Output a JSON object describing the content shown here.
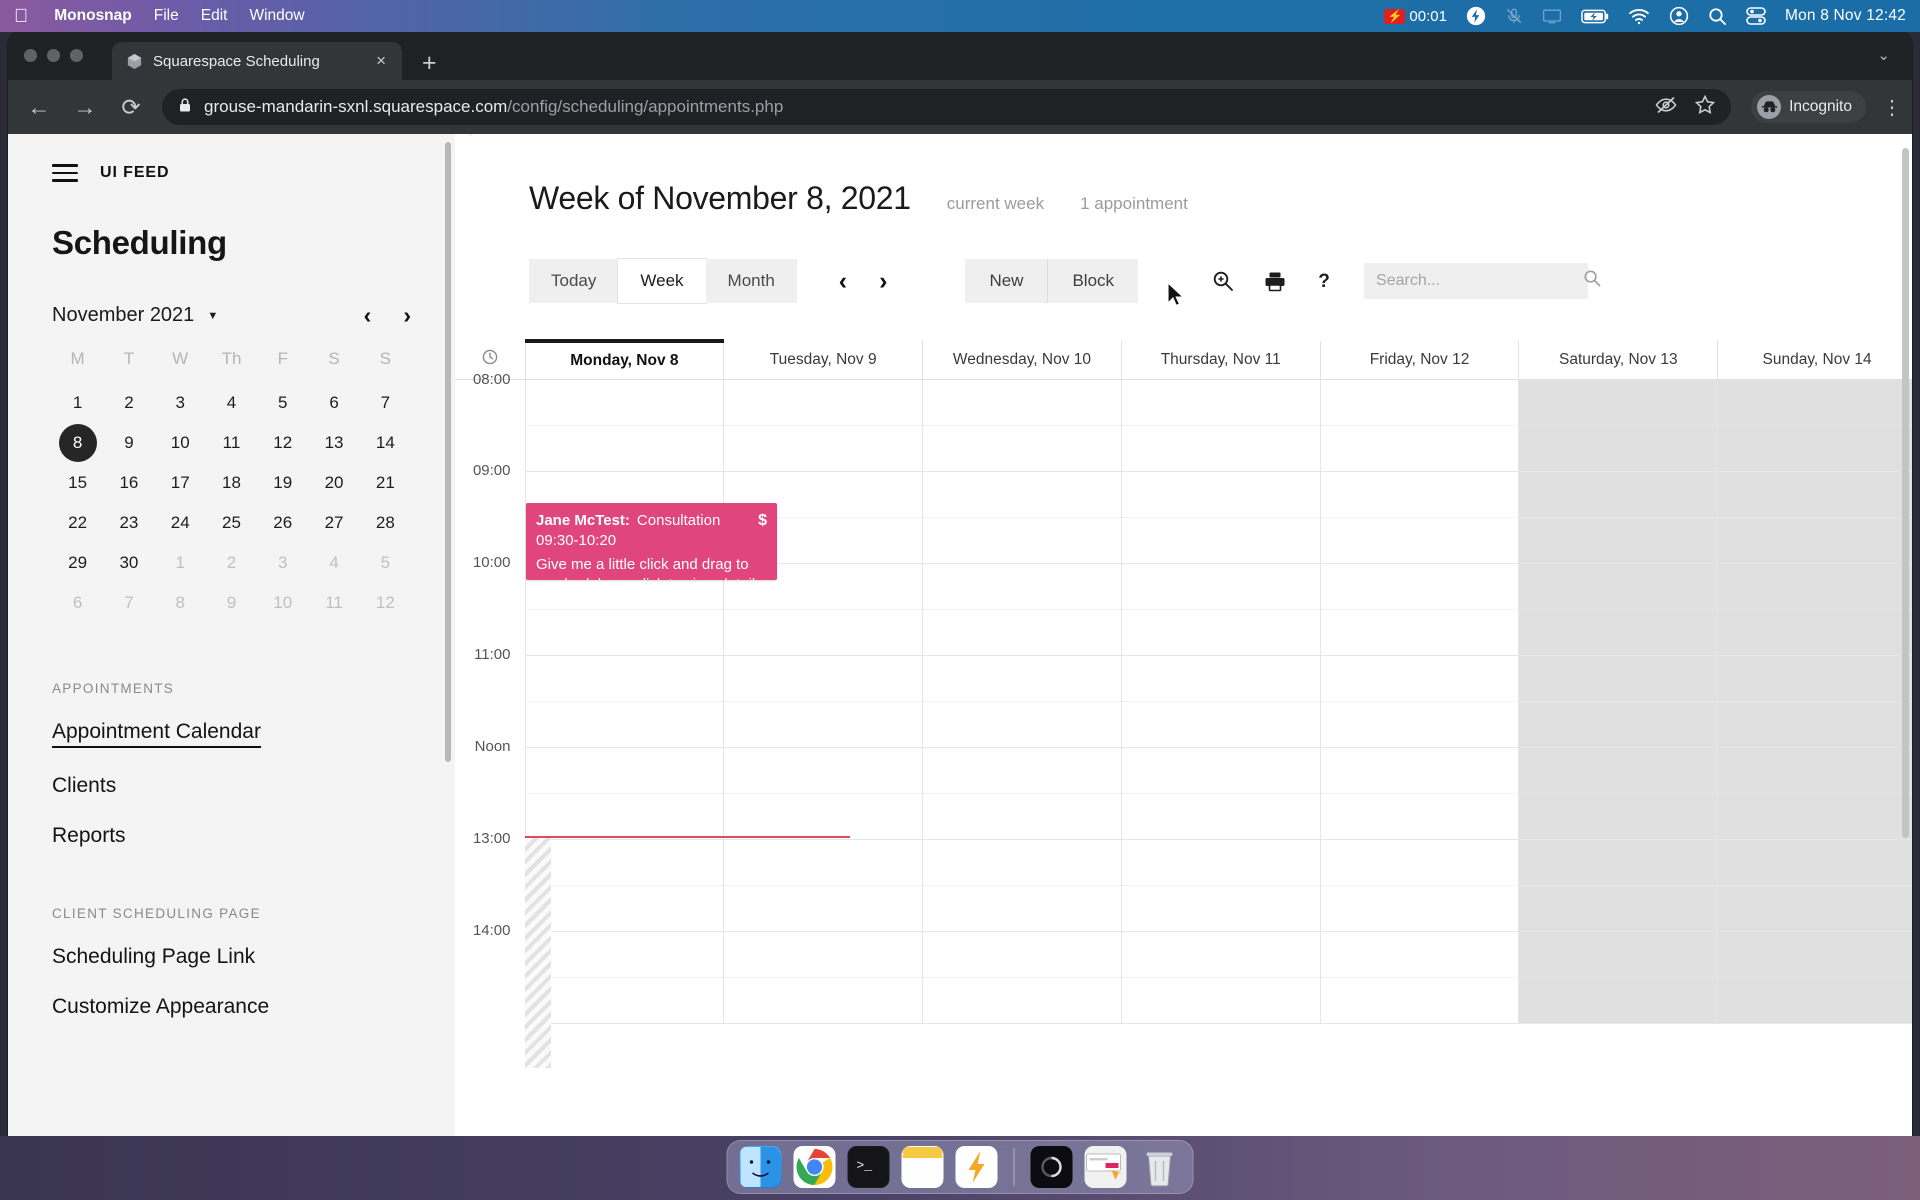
{
  "menubar": {
    "apple": "apple-logo",
    "items": [
      {
        "label": "Monosnap",
        "bold": true
      },
      {
        "label": "File",
        "bold": false
      },
      {
        "label": "Edit",
        "bold": false
      },
      {
        "label": "Window",
        "bold": false
      }
    ],
    "recording_time": "00:01",
    "status_icons": [
      "bolt-icon",
      "microphone-muted-icon",
      "screen-share-icon",
      "battery-charging-icon",
      "wifi-icon",
      "account-icon",
      "search-icon",
      "control-center-icon"
    ],
    "clock": "Mon 8 Nov  12:42",
    "date": "Mon 8 Nov",
    "time": "12:42"
  },
  "browser": {
    "tab": {
      "title": "Squarespace Scheduling",
      "close": "×",
      "favicon": "cube-icon"
    },
    "new_tab": "+",
    "collapse": "⌄",
    "nav": {
      "back": "←",
      "forward": "→",
      "reload": "⟳"
    },
    "url_host": "grouse-mandarin-sxnl.squarespace.com",
    "url_path": "/config/scheduling/appointments.php",
    "profile_label": "Incognito",
    "kebab": "⋮"
  },
  "sidebar": {
    "brand": "UI FEED",
    "page_title": "Scheduling",
    "calendar": {
      "month_label": "November 2021",
      "prev": "‹",
      "next": "›",
      "weekday_headers": [
        "M",
        "T",
        "W",
        "Th",
        "F",
        "S",
        "S"
      ],
      "weeks": [
        [
          {
            "d": "1",
            "muted": false
          },
          {
            "d": "2",
            "muted": false
          },
          {
            "d": "3",
            "muted": false
          },
          {
            "d": "4",
            "muted": false
          },
          {
            "d": "5",
            "muted": false
          },
          {
            "d": "6",
            "muted": false
          },
          {
            "d": "7",
            "muted": false
          }
        ],
        [
          {
            "d": "8",
            "muted": false,
            "selected": true
          },
          {
            "d": "9",
            "muted": false
          },
          {
            "d": "10",
            "muted": false
          },
          {
            "d": "11",
            "muted": false
          },
          {
            "d": "12",
            "muted": false
          },
          {
            "d": "13",
            "muted": false
          },
          {
            "d": "14",
            "muted": false
          }
        ],
        [
          {
            "d": "15",
            "muted": false
          },
          {
            "d": "16",
            "muted": false
          },
          {
            "d": "17",
            "muted": false
          },
          {
            "d": "18",
            "muted": false
          },
          {
            "d": "19",
            "muted": false
          },
          {
            "d": "20",
            "muted": false
          },
          {
            "d": "21",
            "muted": false
          }
        ],
        [
          {
            "d": "22",
            "muted": false
          },
          {
            "d": "23",
            "muted": false
          },
          {
            "d": "24",
            "muted": false
          },
          {
            "d": "25",
            "muted": false
          },
          {
            "d": "26",
            "muted": false
          },
          {
            "d": "27",
            "muted": false
          },
          {
            "d": "28",
            "muted": false
          }
        ],
        [
          {
            "d": "29",
            "muted": false
          },
          {
            "d": "30",
            "muted": false
          },
          {
            "d": "1",
            "muted": true
          },
          {
            "d": "2",
            "muted": true
          },
          {
            "d": "3",
            "muted": true
          },
          {
            "d": "4",
            "muted": true
          },
          {
            "d": "5",
            "muted": true
          }
        ],
        [
          {
            "d": "6",
            "muted": true
          },
          {
            "d": "7",
            "muted": true
          },
          {
            "d": "8",
            "muted": true
          },
          {
            "d": "9",
            "muted": true
          },
          {
            "d": "10",
            "muted": true
          },
          {
            "d": "11",
            "muted": true
          },
          {
            "d": "12",
            "muted": true
          }
        ]
      ]
    },
    "sections": [
      {
        "label": "APPOINTMENTS",
        "links": [
          {
            "label": "Appointment Calendar",
            "active": true
          },
          {
            "label": "Clients",
            "active": false
          },
          {
            "label": "Reports",
            "active": false
          }
        ]
      },
      {
        "label": "CLIENT SCHEDULING PAGE",
        "links": [
          {
            "label": "Scheduling Page Link",
            "active": false
          },
          {
            "label": "Customize Appearance",
            "active": false
          }
        ]
      }
    ]
  },
  "main": {
    "week_title": "Week of November 8, 2021",
    "current_week_note": "current week",
    "appointment_count": "1 appointment",
    "view_tabs": [
      {
        "label": "Today",
        "active": false
      },
      {
        "label": "Week",
        "active": true
      },
      {
        "label": "Month",
        "active": false
      }
    ],
    "prev_arrow": "‹",
    "next_arrow": "›",
    "actions": [
      {
        "label": "New"
      },
      {
        "label": "Block"
      }
    ],
    "tool_icons": [
      "zoom-in-icon",
      "print-icon",
      "help-icon"
    ],
    "search": {
      "value": "",
      "placeholder": "Search...",
      "icon": "search-icon"
    },
    "day_columns": [
      {
        "label": "Monday, Nov 8",
        "today": true,
        "weekend": false
      },
      {
        "label": "Tuesday, Nov 9",
        "today": false,
        "weekend": false
      },
      {
        "label": "Wednesday, Nov 10",
        "today": false,
        "weekend": false
      },
      {
        "label": "Thursday, Nov 11",
        "today": false,
        "weekend": false
      },
      {
        "label": "Friday, Nov 12",
        "today": false,
        "weekend": false
      },
      {
        "label": "Saturday, Nov 13",
        "today": false,
        "weekend": true
      },
      {
        "label": "Sunday, Nov 14",
        "today": false,
        "weekend": true
      }
    ],
    "time_slots": [
      "08:00",
      "09:00",
      "10:00",
      "11:00",
      "Noon",
      "13:00",
      "14:00"
    ],
    "appointments": [
      {
        "client": "Jane McTest:",
        "type": "Consultation",
        "time": "09:30-10:20",
        "hint": "Give me a little click and drag to reschedule, or click to view details.",
        "badge": "$",
        "color": "#e0457b",
        "day": "Monday, Nov 8"
      }
    ],
    "now_time": "12:42"
  },
  "dock": {
    "items": [
      "finder-icon",
      "chrome-icon",
      "terminal-icon",
      "notes-icon",
      "monosnap-icon",
      "separator",
      "screenshot-icon",
      "snippet-icon",
      "trash-icon"
    ]
  }
}
